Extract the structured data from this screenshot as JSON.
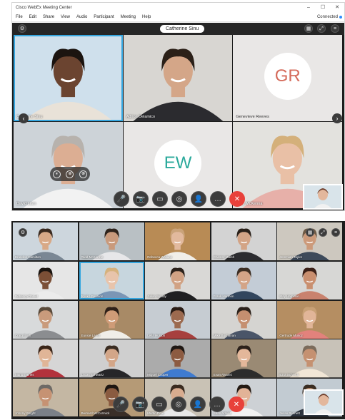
{
  "window": {
    "title": "Cisco WebEx Meeting Center",
    "controls": [
      "–",
      "☐",
      "✕"
    ],
    "menu": [
      "File",
      "Edit",
      "Share",
      "View",
      "Audio",
      "Participant",
      "Meeting",
      "Help"
    ],
    "status": "Connected",
    "status_color": "#2d8cff"
  },
  "active_speaker": "Catherine Sinu",
  "top_tiles": [
    {
      "name": "Catherine Sinu",
      "type": "video",
      "selected": true,
      "bg": "#cfe0ec",
      "skin": "#6b4430",
      "hair": "#1b1410",
      "shirt": "#e9e2d8"
    },
    {
      "name": "Adrion Delamico",
      "type": "video",
      "selected": false,
      "bg": "#d8d6d2",
      "skin": "#d4a688",
      "hair": "#2b2018",
      "shirt": "#2b2b2f"
    },
    {
      "name": "Genevieve Reeves",
      "type": "initials",
      "initials": "GR",
      "color": "#d56b5b",
      "bg": "#e9e7e6"
    },
    {
      "name": "David Liam",
      "type": "video",
      "selected": false,
      "bg": "#cdd3d8",
      "skin": "#dcae93",
      "hair": "#b7b2ad",
      "shirt": "#f2f2f2"
    },
    {
      "name": "",
      "type": "initials",
      "initials": "EW",
      "color": "#2aa99b",
      "bg": "#e9e7e6"
    },
    {
      "name": "Mary McKenna",
      "type": "video",
      "selected": false,
      "bg": "#e3e2de",
      "skin": "#e9c0a6",
      "hair": "#d4b07a",
      "shirt": "#e7b0a9"
    }
  ],
  "bottom_tiles": [
    {
      "name": "Brandon Hamilton",
      "bg": "#cdd6dd",
      "skin": "#d8a987",
      "hair": "#3a2a1f",
      "shirt": "#7a8794"
    },
    {
      "name": "Todd McKenzie",
      "bg": "#b9c0c4",
      "skin": "#c99a7c",
      "hair": "#2f241c",
      "shirt": "#e7e7e9"
    },
    {
      "name": "Rebecca Wallace",
      "bg": "#b88b55",
      "skin": "#e2b99d",
      "hair": "#caa37a",
      "shirt": "#f1efe9"
    },
    {
      "name": "Chester Marsh",
      "bg": "#d3d3d3",
      "skin": "#d3a486",
      "hair": "#2a211a",
      "shirt": "#2c2c30"
    },
    {
      "name": "Jeremiah Taylor",
      "bg": "#cdc8bf",
      "skin": "#cc9a7a",
      "hair": "#6e5a45",
      "shirt": "#3d4a5a"
    },
    {
      "name": "Rebecca Daniel",
      "bg": "#e6e6e6",
      "skin": "#7b4f36",
      "hair": "#1a1410",
      "shirt": "#ececec"
    },
    {
      "name": "Ryoko Pearson",
      "bg": "#c7d6de",
      "skin": "#e8c4ab",
      "hair": "#d6b27d",
      "shirt": "#7b96b5",
      "selected": true
    },
    {
      "name": "Julian Moody",
      "bg": "#d9d8d6",
      "skin": "#d1a284",
      "hair": "#2c221b",
      "shirt": "#1f1f22"
    },
    {
      "name": "Frank Harmon",
      "bg": "#c3ccd6",
      "skin": "#d3a487",
      "hair": "#3c2e23",
      "shirt": "#32465e"
    },
    {
      "name": "May Hamilton",
      "bg": "#d7d7d5",
      "skin": "#c98f6f",
      "hair": "#3b2017",
      "shirt": "#c9826e"
    },
    {
      "name": "Craig Bush",
      "bg": "#d8dadb",
      "skin": "#c99b7c",
      "hair": "#5a4a3a",
      "shirt": "#8b8d90"
    },
    {
      "name": "Eunice Lamb",
      "bg": "#a88a66",
      "skin": "#cf9b77",
      "hair": "#2f2018",
      "shirt": "#f0eee8"
    },
    {
      "name": "Leila Huston",
      "bg": "#c6ccd2",
      "skin": "#9c6a4f",
      "hair": "#2a1c15",
      "shirt": "#a7403e"
    },
    {
      "name": "Mike Buchanan",
      "bg": "#d5d4d1",
      "skin": "#c58f70",
      "hair": "#2b211a",
      "shirt": "#4a5568"
    },
    {
      "name": "Gertrude Munoz",
      "bg": "#b58e62",
      "skin": "#e1b598",
      "hair": "#c8a075",
      "shirt": "#e2827c"
    },
    {
      "name": "Marion Hines",
      "bg": "#d6d6d6",
      "skin": "#e0b597",
      "hair": "#3a2518",
      "shirt": "#b3323c"
    },
    {
      "name": "Lucas Schwartz",
      "bg": "#cfcfcf",
      "skin": "#d3a688",
      "hair": "#3a2c21",
      "shirt": "#262628"
    },
    {
      "name": "Miguel Cooper",
      "bg": "#ababab",
      "skin": "#8c5b41",
      "hair": "#1e1713",
      "shirt": "#3f7bd0"
    },
    {
      "name": "Evan Alvarez",
      "bg": "#9a8a74",
      "skin": "#e3b79a",
      "hair": "#2b211b",
      "shirt": "#2c2c2c"
    },
    {
      "name": "Ezra Schmidt",
      "bg": "#c8c2b8",
      "skin": "#c59171",
      "hair": "#7b6b5b",
      "shirt": "#f1e6d6"
    },
    {
      "name": "Johnny Wright",
      "bg": "#c4b7a3",
      "skin": "#c69273",
      "hair": "#6e6a66",
      "shirt": "#7b8088"
    },
    {
      "name": "Bernard McCormick",
      "bg": "#b59a76",
      "skin": "#8a5b40",
      "hair": "#1d1612",
      "shirt": "#3a2f28"
    },
    {
      "name": "Martin Dear",
      "bg": "#c9c2b5",
      "skin": "#d9ac8f",
      "hair": "#3a2b20",
      "shirt": "#e8e8e8"
    },
    {
      "name": "Sean Adkins",
      "bg": "#cdd1d5",
      "skin": "#e2b397",
      "hair": "#241a13",
      "shirt": "#f2f2f2"
    },
    {
      "name": "Jesse Bennett",
      "bg": "#c2cbd2",
      "skin": "#cf9f7f",
      "hair": "#3a2d22",
      "shirt": "#2d3540"
    }
  ],
  "toolbar": [
    {
      "name": "mute-button",
      "icon": "🎤"
    },
    {
      "name": "video-button",
      "icon": "📷"
    },
    {
      "name": "share-button",
      "icon": "▭"
    },
    {
      "name": "record-button",
      "icon": "◎"
    },
    {
      "name": "participants-button",
      "icon": "👤"
    },
    {
      "name": "more-button",
      "icon": "…"
    },
    {
      "name": "end-call-button",
      "icon": "✕"
    }
  ],
  "tile_overlay_icons": [
    "⏸",
    "⊕",
    "⊗"
  ]
}
